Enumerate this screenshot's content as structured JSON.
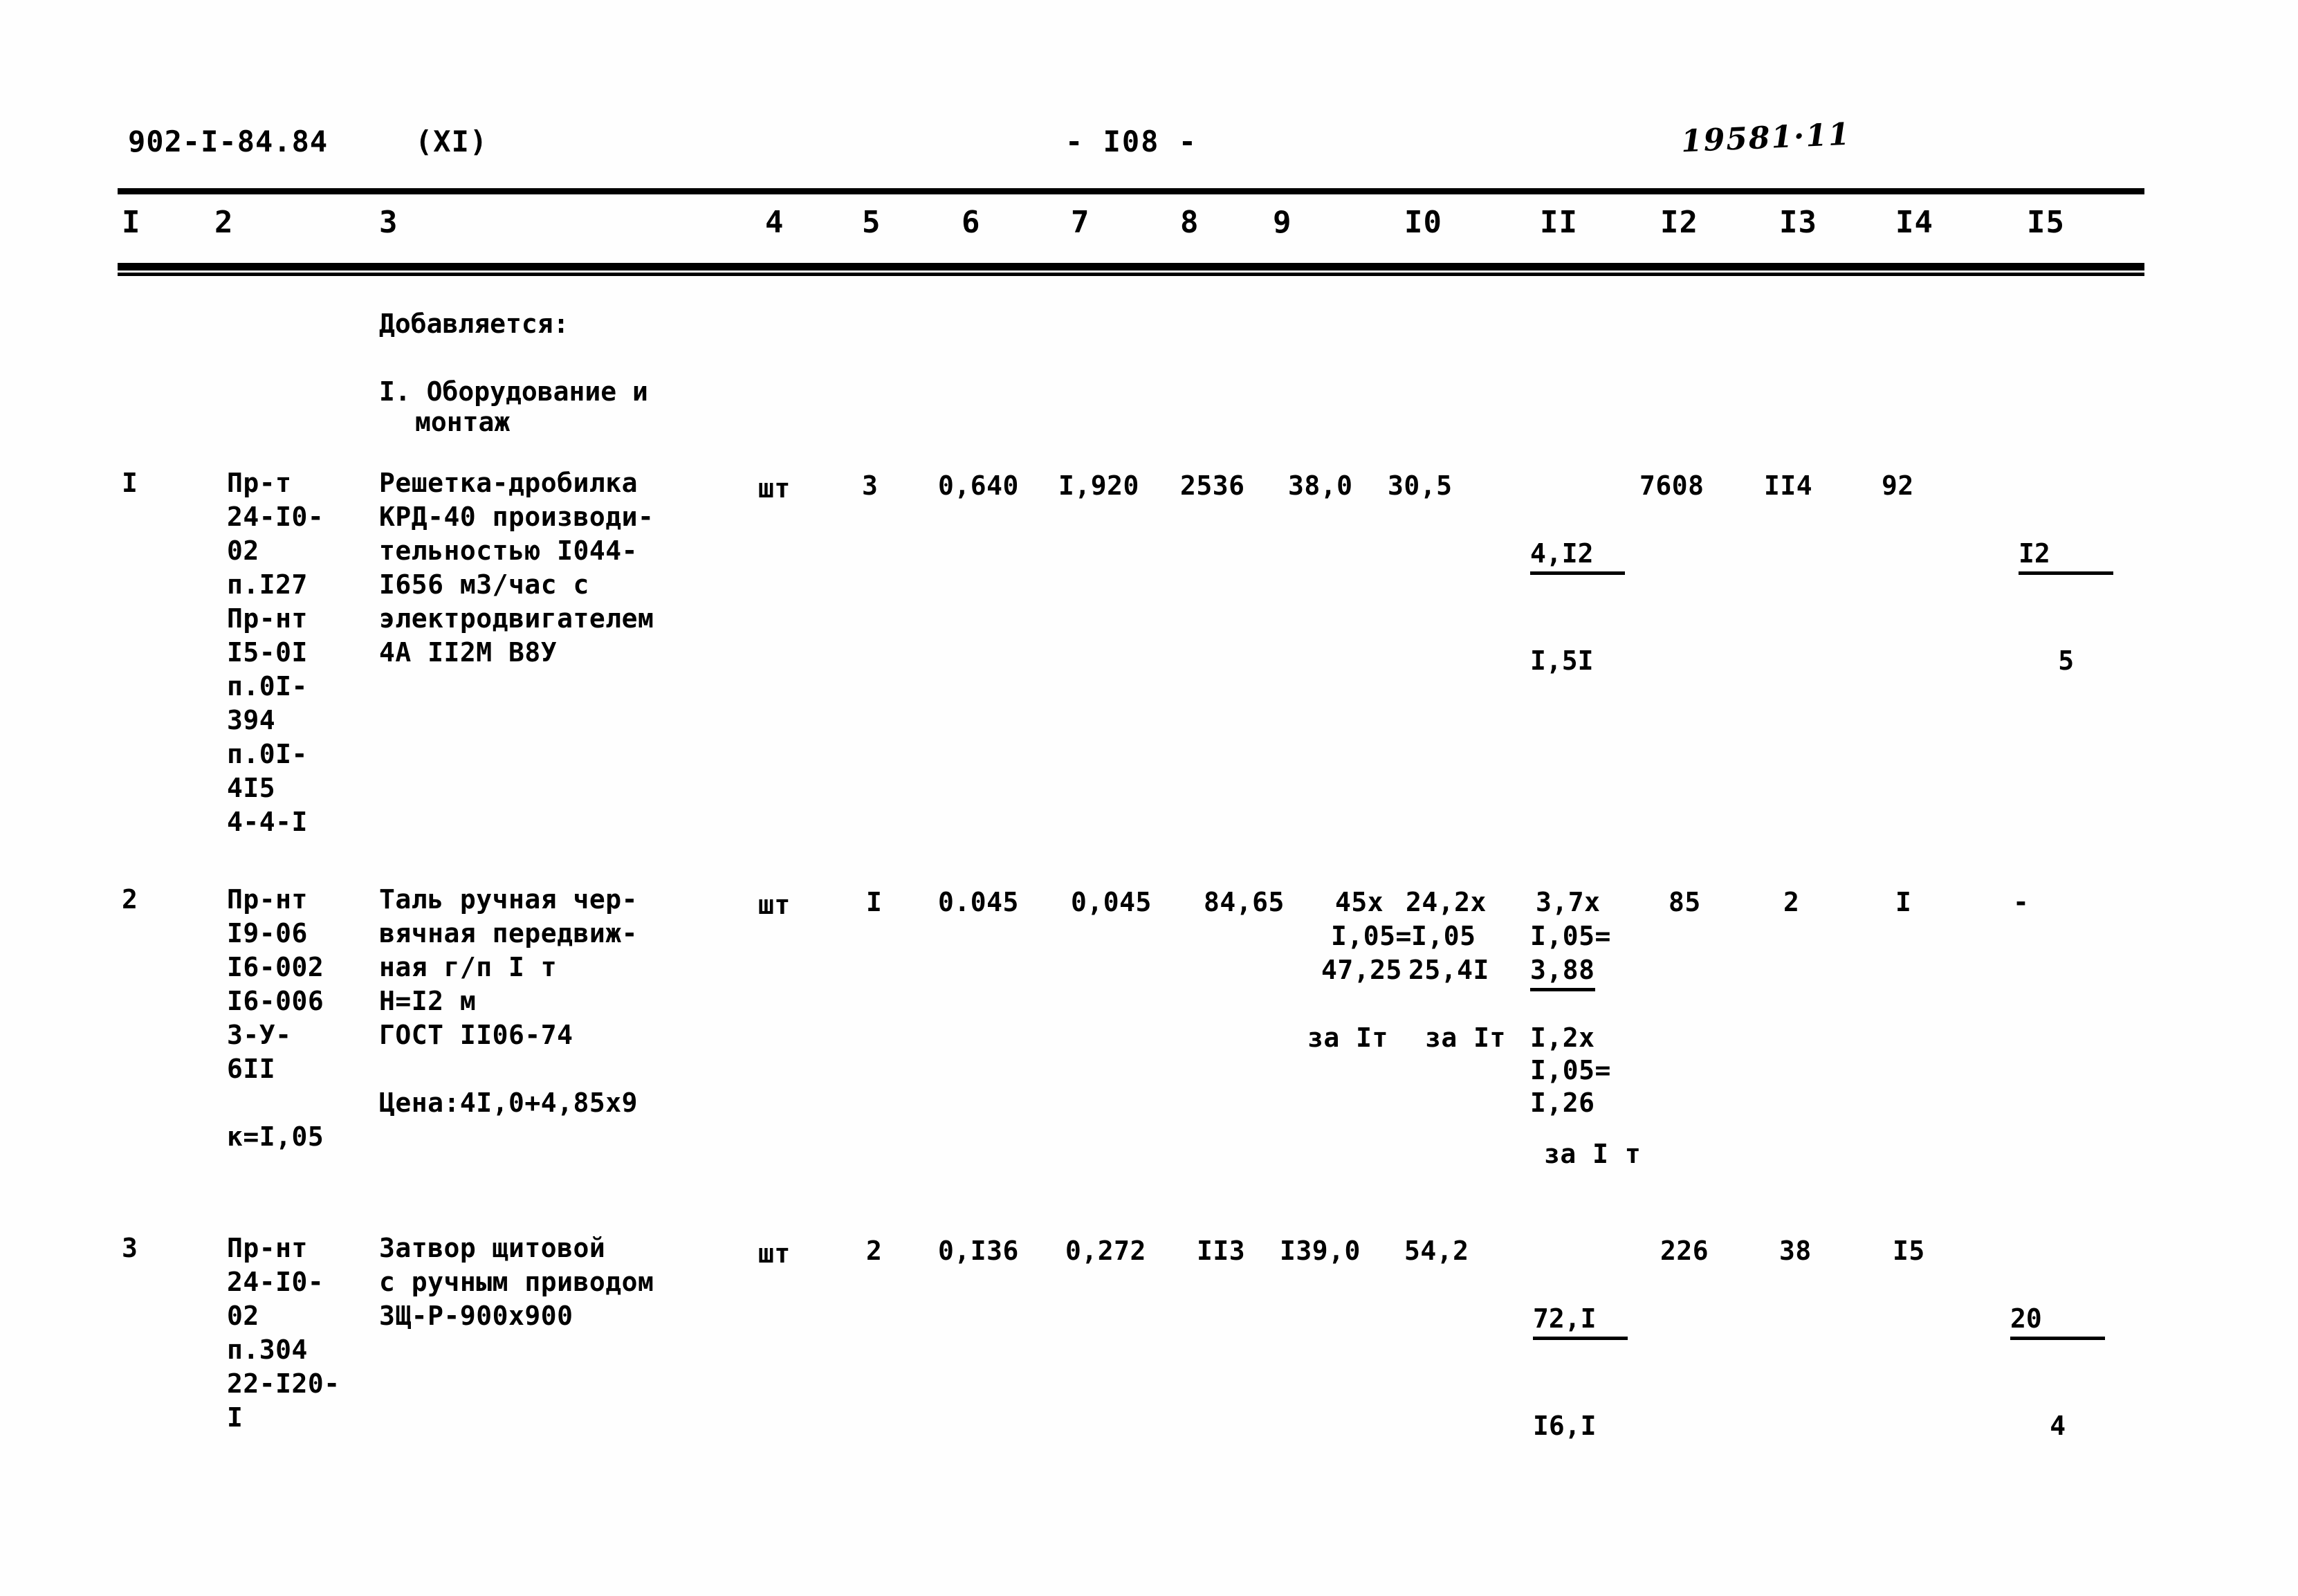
{
  "header": {
    "doc_code": "902-I-84.84",
    "part": "(XI)",
    "page_number": "- I08 -",
    "stamp_number": "19581·11"
  },
  "column_headers": [
    "I",
    "2",
    "3",
    "4",
    "5",
    "6",
    "7",
    "8",
    "9",
    "I0",
    "II",
    "I2",
    "I3",
    "I4",
    "I5"
  ],
  "intro": {
    "added_label": "Добавляется:",
    "section_line1": "I. Оборудование и",
    "section_line2": "монтаж"
  },
  "rows": [
    {
      "no": "I",
      "code": "Пр-т\n24-I0-\n02\nп.I27\nПр-нт\nI5-0I\nп.0I-\n394\nп.0I-\n4I5\n4-4-I",
      "description": "Решетка-дробилка\nКРД-40 производи-\nтельностью I044-\nI656 м3/час с\nэлектродвигателем\n4А II2М В8У",
      "unit": "шт",
      "qty": "3",
      "c6": "0,640",
      "c7": "I,920",
      "c8": "2536",
      "c9": "38,0",
      "c10": "30,5",
      "c11_num": "4,I2",
      "c11_den": "I,5I",
      "c12": "7608",
      "c13": "II4",
      "c14": "92",
      "c15_num": "I2",
      "c15_den": "5"
    },
    {
      "no": "2",
      "code": "Пр-нт\nI9-06\nI6-002\nI6-006\n3-У-\n6II\n\nк=I,05",
      "description": "Таль ручная чер-\nвячная передвиж-\nная г/п I т\nН=I2 м\nГОСТ II06-74\n\nЦена:4I,0+4,85х9",
      "unit": "шт",
      "qty": "I",
      "c6": "0.045",
      "c7": "0,045",
      "c8": "84,65",
      "c9_line1": "45х",
      "c9_line2": "I,05=",
      "c9_line3": "47,25",
      "c9_line4": "за Iт",
      "c10_line1": "24,2х",
      "c10_line2": "I,05",
      "c10_line3": "25,4I",
      "c10_line4": "за Iт",
      "c11_line1": "3,7х",
      "c11_line2": "I,05=",
      "c11_line3": "3,88",
      "c11_line4": "I,2х",
      "c11_line5": "I,05=",
      "c11_line6": "I,26",
      "c11_line7": "за I т",
      "c12": "85",
      "c13": "2",
      "c14": "I",
      "c15": "-"
    },
    {
      "no": "3",
      "code": "Пр-нт\n24-I0-\n02\nп.304\n22-I20-\nI",
      "description": "Затвор щитовой\nс ручным приводом\nЗЩ-Р-900х900",
      "unit": "шт",
      "qty": "2",
      "c6": "0,I36",
      "c7": "0,272",
      "c8": "II3",
      "c9": "I39,0",
      "c10": "54,2",
      "c11_num": "72,I",
      "c11_den": "I6,I",
      "c12": "226",
      "c13": "38",
      "c14": "I5",
      "c15_num": "20",
      "c15_den": "4"
    }
  ]
}
